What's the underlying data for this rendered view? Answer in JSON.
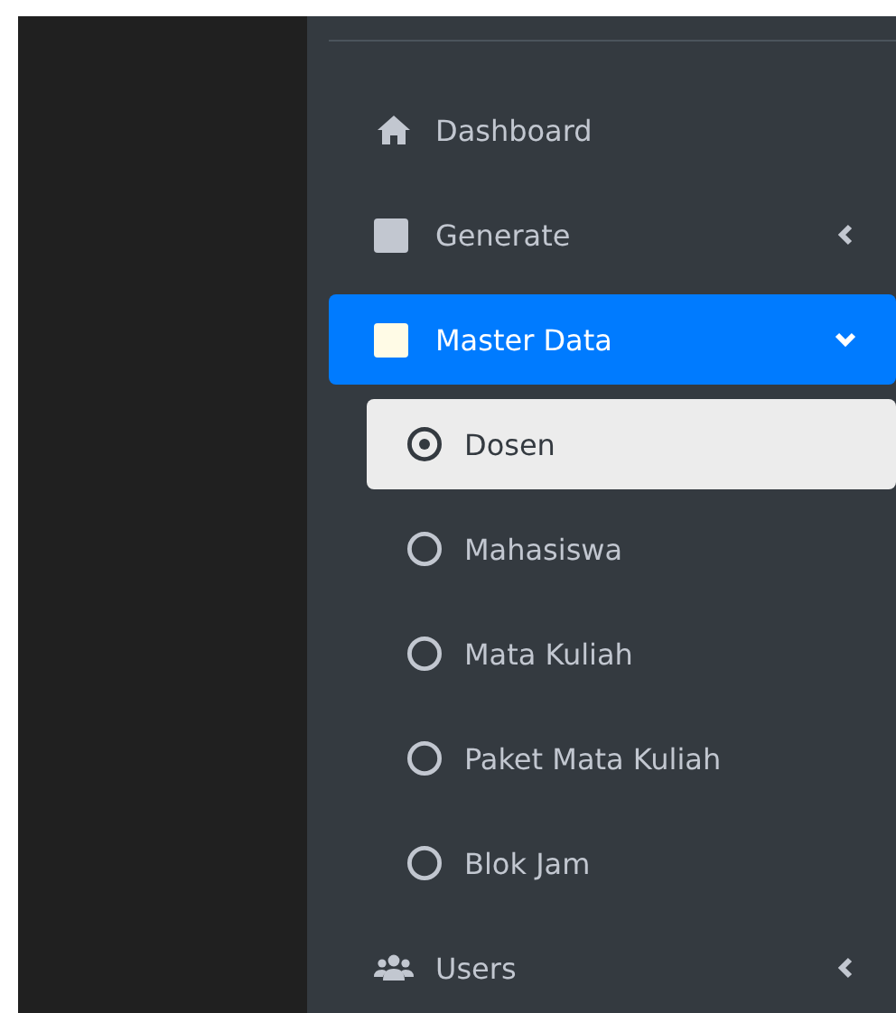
{
  "sidebar": {
    "items": [
      {
        "label": "Dashboard",
        "selected": false
      },
      {
        "label": "Generate",
        "selected": false,
        "expanded": false
      },
      {
        "label": "Master Data",
        "selected": true,
        "expanded": true,
        "children": [
          {
            "label": "Dosen",
            "selected": true
          },
          {
            "label": "Mahasiswa",
            "selected": false
          },
          {
            "label": "Mata Kuliah",
            "selected": false
          },
          {
            "label": "Paket Mata Kuliah",
            "selected": false
          },
          {
            "label": "Blok Jam",
            "selected": false
          }
        ]
      },
      {
        "label": "Users",
        "selected": false,
        "expanded": false
      }
    ]
  }
}
